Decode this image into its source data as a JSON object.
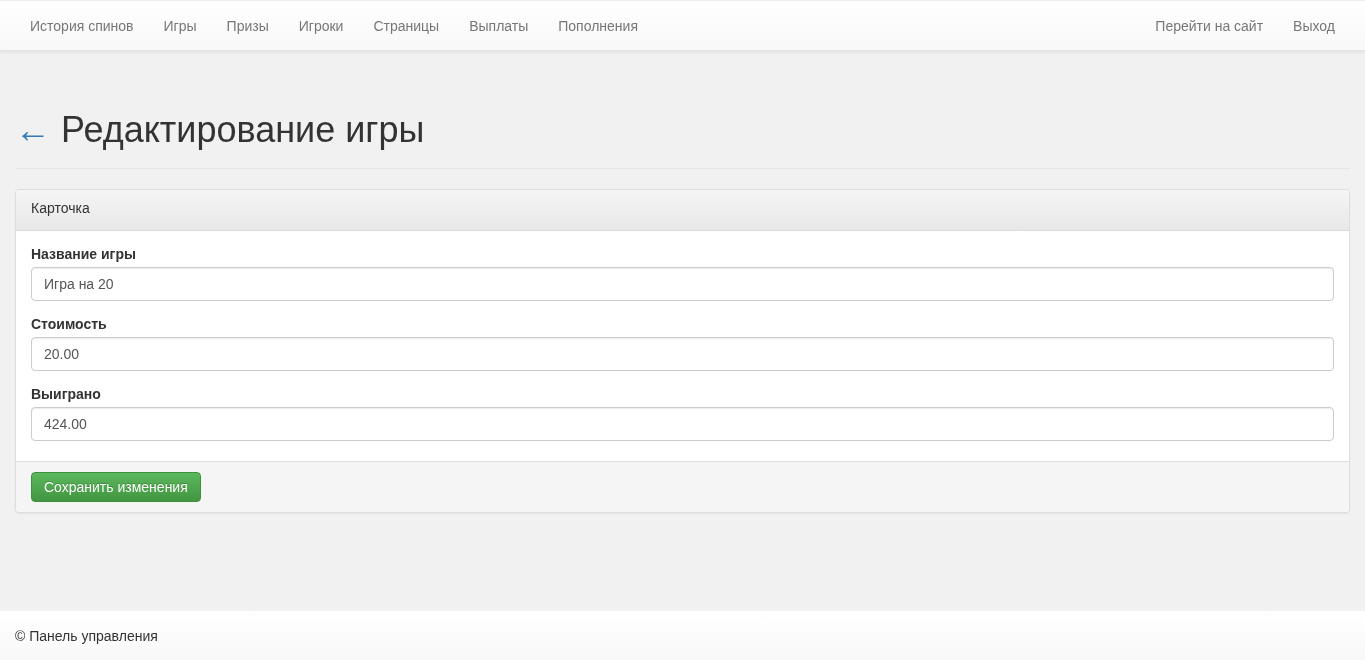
{
  "navbar": {
    "left_links": [
      "История спинов",
      "Игры",
      "Призы",
      "Игроки",
      "Страницы",
      "Выплаты",
      "Пополнения"
    ],
    "right_links": [
      "Перейти на сайт",
      "Выход"
    ]
  },
  "header": {
    "back": "←",
    "title": "Редактирование игры"
  },
  "panel": {
    "heading": "Карточка",
    "fields": [
      {
        "label": "Название игры",
        "value": "Игра на 20"
      },
      {
        "label": "Стоимость",
        "value": "20.00"
      },
      {
        "label": "Выиграно",
        "value": "424.00"
      }
    ],
    "save_button": "Сохранить изменения"
  },
  "footer": {
    "text": "© Панель управления"
  }
}
